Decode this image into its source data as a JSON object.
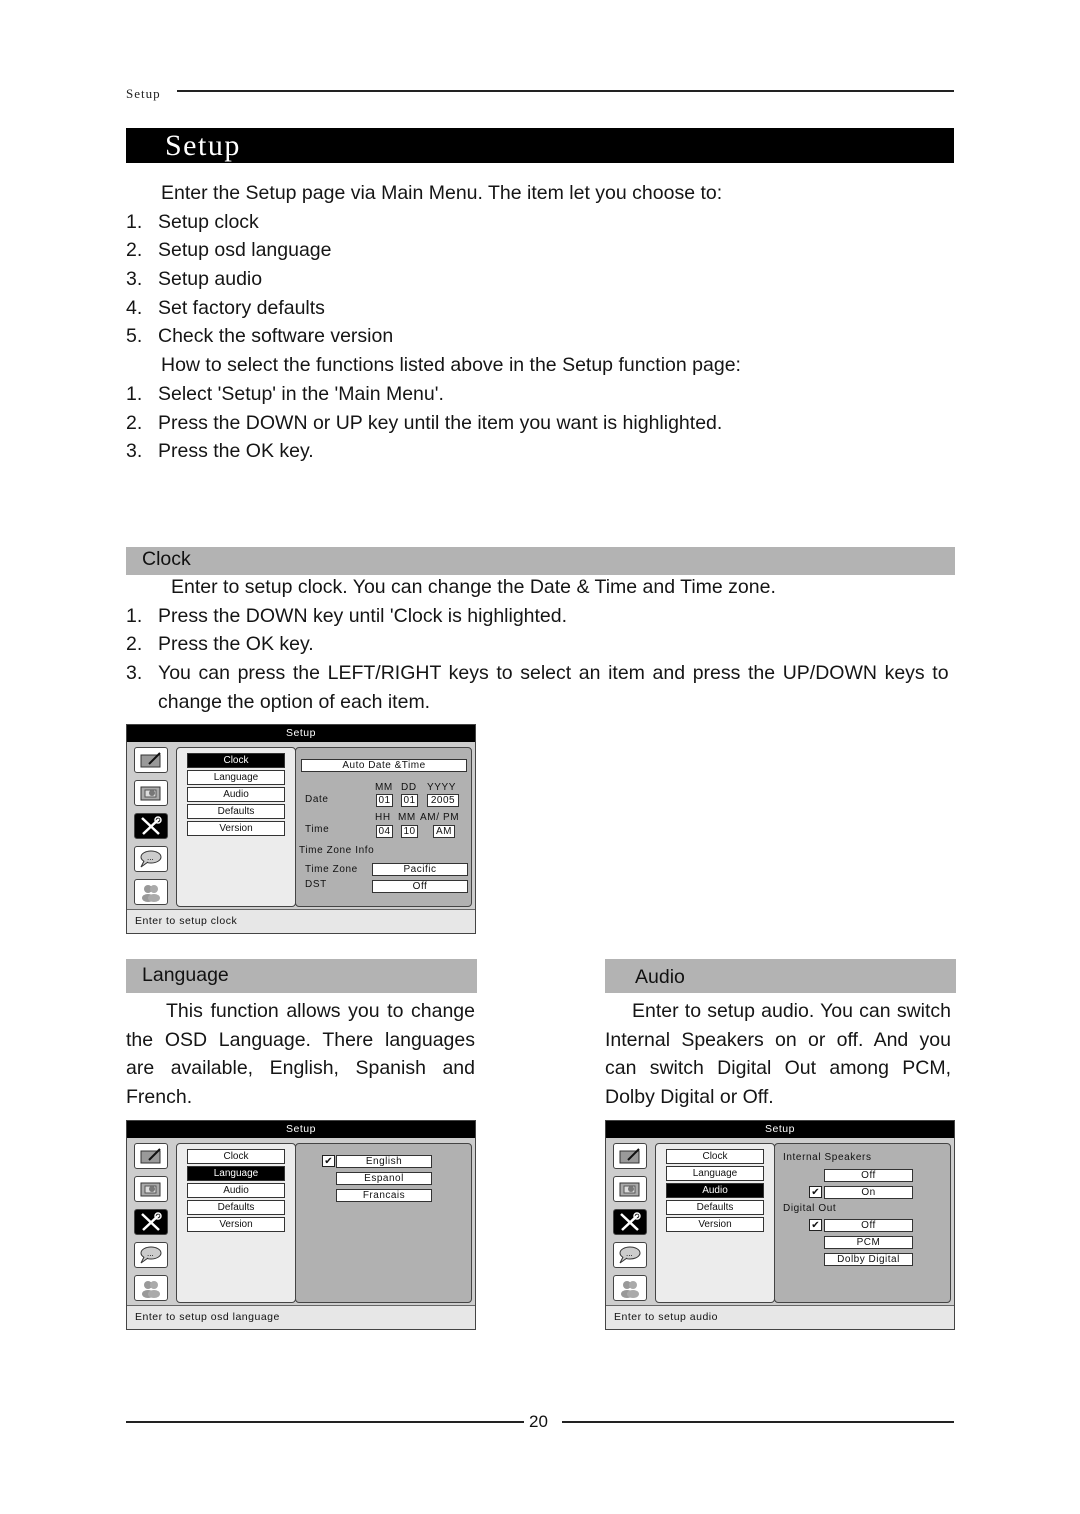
{
  "running_header": "Setup",
  "title": "Setup",
  "intro": {
    "lead": "Enter the Setup page via Main Menu. The item let you choose to:",
    "items": [
      {
        "n": "1.",
        "text": "Setup clock"
      },
      {
        "n": "2.",
        "text": "Setup osd language"
      },
      {
        "n": "3.",
        "text": "Setup audio"
      },
      {
        "n": "4.",
        "text": "Set factory defaults"
      },
      {
        "n": "5.",
        "text": "Check the software version"
      }
    ],
    "how_lead": "How to select the functions listed above in the Setup function page:",
    "steps": [
      {
        "n": "1.",
        "text": "Select 'Setup' in the 'Main Menu'."
      },
      {
        "n": "2.",
        "text": "Press the DOWN or  UP key until the item you want is highlighted."
      },
      {
        "n": "3.",
        "text": "Press the OK key."
      }
    ]
  },
  "clock": {
    "heading": "Clock",
    "lead": "Enter to setup clock. You can change the Date & Time and Time zone.",
    "steps": [
      {
        "n": "1.",
        "text": "Press the DOWN key until 'Clock is highlighted."
      },
      {
        "n": "2.",
        "text": "Press the OK key."
      },
      {
        "n": "3.",
        "text": "You can press the LEFT/RIGHT keys to select an item and press the UP/DOWN keys to"
      }
    ],
    "step3_cont": "change the option of each item.",
    "osd": {
      "title": "Setup",
      "menu": [
        "Clock",
        "Language",
        "Audio",
        "Defaults",
        "Version"
      ],
      "selected": "Clock",
      "auto": "Auto Date   &Time",
      "date_label": "Date",
      "date_heads": [
        "MM",
        "DD",
        "YYYY"
      ],
      "date_values": [
        "01",
        "01",
        "2005"
      ],
      "time_label": "Time",
      "time_heads": [
        "HH",
        "MM",
        "AM/ PM"
      ],
      "time_values": [
        "04",
        "10",
        "AM"
      ],
      "tz_info": "Time Zone Info",
      "tz_label": "Time Zone",
      "tz_value": "Pacific",
      "dst_label": "DST",
      "dst_value": "Off",
      "footer": "Enter to setup clock"
    }
  },
  "language": {
    "heading": "Language",
    "body": "This function allows you to change the OSD Language. There languages are available, English, Spanish and French.",
    "osd": {
      "title": "Setup",
      "menu": [
        "Clock",
        "Language",
        "Audio",
        "Defaults",
        "Version"
      ],
      "selected": "Language",
      "options": [
        "English",
        "Espanol",
        "Francais"
      ],
      "checked": "English",
      "check_mark": "✔",
      "footer": "Enter to setup osd language"
    }
  },
  "audio": {
    "heading": "Audio",
    "body": "Enter to setup audio. You can switch Internal Speakers on or off. And you can switch Digital Out among PCM, Dolby Digital or Off.",
    "osd": {
      "title": "Setup",
      "menu": [
        "Clock",
        "Language",
        "Audio",
        "Defaults",
        "Version"
      ],
      "selected": "Audio",
      "speakers_label": "Internal Speakers",
      "speakers_options": [
        "Off",
        "On"
      ],
      "speakers_checked": "On",
      "digital_label": "Digital Out",
      "digital_options": [
        "Off",
        "PCM",
        "Dolby Digital"
      ],
      "digital_checked": "Off",
      "check_mark": "✔",
      "footer": "Enter to setup audio"
    }
  },
  "page_number": "20",
  "osd_icons": [
    "edit-screen-icon",
    "picture-icon",
    "tools-icon",
    "speech-bubble-icon",
    "users-icon"
  ]
}
